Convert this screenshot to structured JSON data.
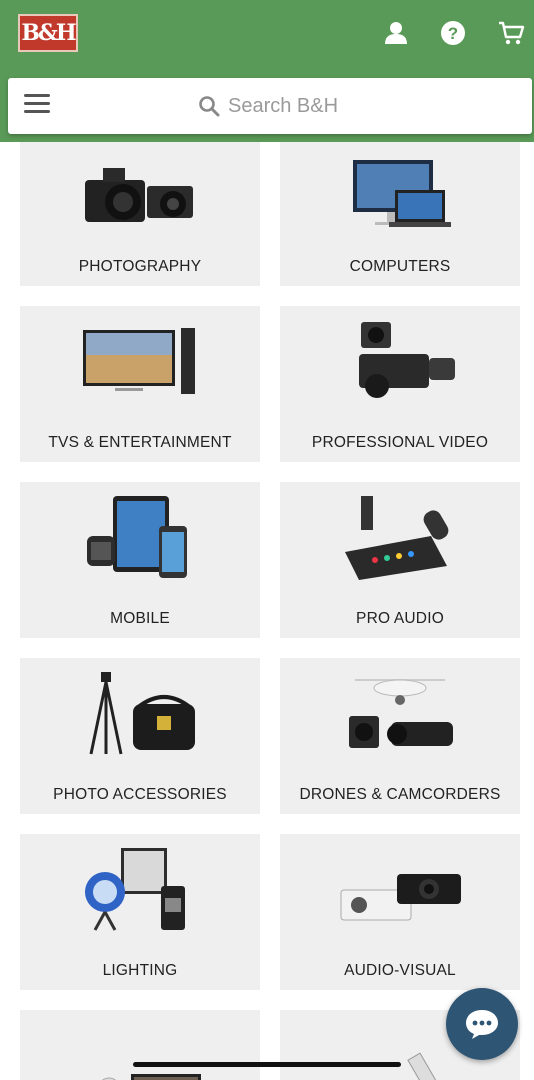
{
  "header": {
    "logo_text": "B&H",
    "brand_color": "#5a9a58",
    "icons": [
      "account-icon",
      "help-icon",
      "cart-icon"
    ]
  },
  "search": {
    "placeholder": "Search B&H"
  },
  "categories": [
    {
      "label": "PHOTOGRAPHY",
      "icon": "camera-icon"
    },
    {
      "label": "COMPUTERS",
      "icon": "computer-icon"
    },
    {
      "label": "TVS & ENTERTAINMENT",
      "icon": "tv-icon"
    },
    {
      "label": "PROFESSIONAL VIDEO",
      "icon": "video-camera-icon"
    },
    {
      "label": "MOBILE",
      "icon": "mobile-icon"
    },
    {
      "label": "PRO AUDIO",
      "icon": "microphone-icon"
    },
    {
      "label": "PHOTO ACCESSORIES",
      "icon": "tripod-icon"
    },
    {
      "label": "DRONES & CAMCORDERS",
      "icon": "drone-icon"
    },
    {
      "label": "LIGHTING",
      "icon": "light-icon"
    },
    {
      "label": "AUDIO-VISUAL",
      "icon": "projector-icon"
    },
    {
      "label": "",
      "icon": "security-camera-icon"
    },
    {
      "label": "",
      "icon": "binoculars-icon"
    }
  ],
  "chat": {
    "icon": "chat-icon",
    "color": "#2f5574"
  }
}
